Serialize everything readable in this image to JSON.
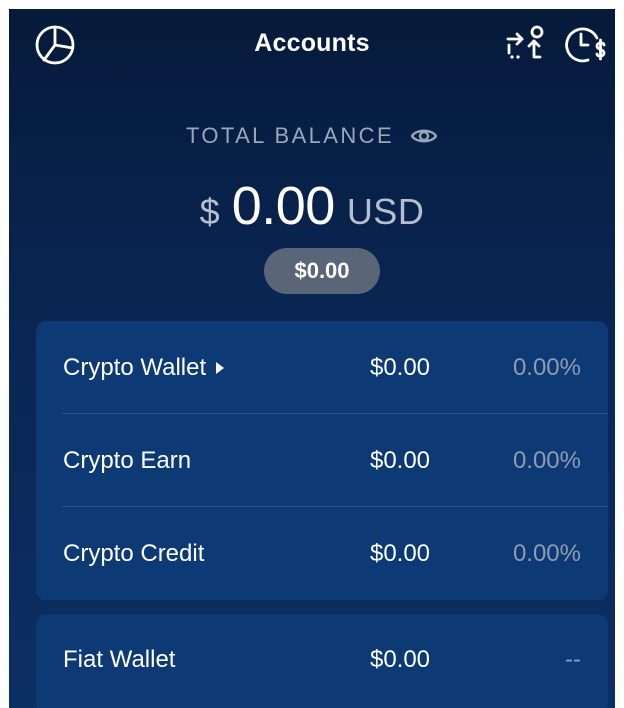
{
  "header": {
    "title": "Accounts",
    "icons": [
      "pie-chart-icon",
      "transfer-icon",
      "clock-dollar-icon"
    ]
  },
  "balance": {
    "label": "TOTAL BALANCE",
    "currency_symbol": "$",
    "amount": "0.00",
    "currency_code": "USD",
    "secondary": "$0.00"
  },
  "accounts": [
    {
      "name": "Crypto Wallet",
      "value": "$0.00",
      "percent": "0.00%",
      "has_caret": true
    },
    {
      "name": "Crypto Earn",
      "value": "$0.00",
      "percent": "0.00%"
    },
    {
      "name": "Crypto Credit",
      "value": "$0.00",
      "percent": "0.00%"
    }
  ],
  "fiat": {
    "name": "Fiat Wallet",
    "value": "$0.00",
    "percent": "--"
  },
  "colors": {
    "background_top": "#061a3a",
    "background_bottom": "#0c2f63",
    "card": "#0d3a75",
    "pill": "#5a6577",
    "muted_text": "#9aa6ba"
  }
}
